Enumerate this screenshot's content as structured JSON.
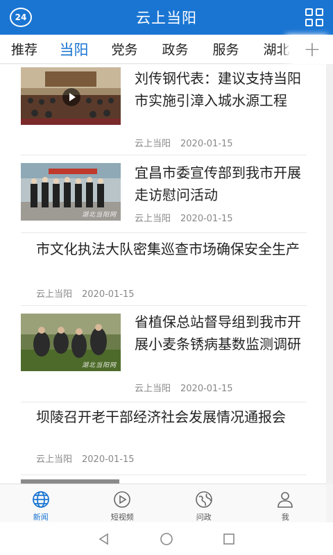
{
  "header": {
    "badge": "24",
    "title": "云上当阳",
    "grid_icon": "grid-icon"
  },
  "tabs": [
    {
      "label": "推荐",
      "active": false
    },
    {
      "label": "当阳",
      "active": true
    },
    {
      "label": "党务",
      "active": false
    },
    {
      "label": "政务",
      "active": false
    },
    {
      "label": "服务",
      "active": false
    },
    {
      "label": "湖北",
      "active": false
    }
  ],
  "tab_plus": "+",
  "feed": [
    {
      "title": "刘传钢代表：建议支持当阳市实施引漳入城水源工程",
      "source": "云上当阳",
      "date": "2020-01-15",
      "has_image": true,
      "is_video": true
    },
    {
      "title": "宜昌市委宣传部到我市开展走访慰问活动",
      "source": "云上当阳",
      "date": "2020-01-15",
      "has_image": true,
      "is_video": false,
      "watermark": "湖北当阳网"
    },
    {
      "title": "市文化执法大队密集巡查市场确保安全生产",
      "source": "云上当阳",
      "date": "2020-01-15",
      "has_image": false
    },
    {
      "title": "省植保总站督导组到我市开展小麦条锈病基数监测调研",
      "source": "云上当阳",
      "date": "2020-01-15",
      "has_image": true,
      "is_video": false,
      "watermark": "湖北当阳网"
    },
    {
      "title": "坝陵召开老干部经济社会发展情况通报会",
      "source": "云上当阳",
      "date": "2020-01-15",
      "has_image": false
    }
  ],
  "bottom_nav": [
    {
      "label": "新闻",
      "icon": "globe-icon",
      "active": true
    },
    {
      "label": "短视频",
      "icon": "play-circle-icon",
      "active": false
    },
    {
      "label": "问政",
      "icon": "earth-icon",
      "active": false
    },
    {
      "label": "我",
      "icon": "user-icon",
      "active": false
    }
  ],
  "colors": {
    "accent": "#1a75d2",
    "text": "#222222",
    "meta": "#888888"
  }
}
